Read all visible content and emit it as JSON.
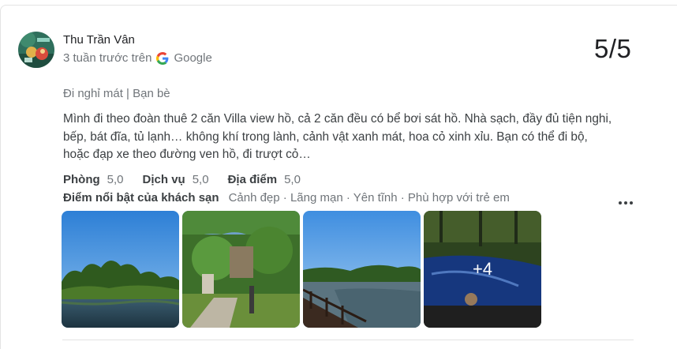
{
  "review": {
    "author": "Thu Trần Vân",
    "time": "3 tuần trước trên",
    "source": "Google",
    "score": "5/5",
    "tags": "Đi nghỉ mát | Bạn bè",
    "text": "Mình đi theo đoàn thuê 2 căn Villa view hồ, cả 2 căn đều có bể bơi sát hồ. Nhà sạch, đầy đủ tiện nghi, bếp, bát đĩa, tủ lạnh… không khí trong lành, cảnh vật xanh mát, hoa cỏ xinh xỉu. Bạn có thể đi bộ, hoặc đạp xe theo đường ven hồ, đi trượt cỏ…",
    "ratings": [
      {
        "label": "Phòng",
        "value": "5,0"
      },
      {
        "label": "Dịch vụ",
        "value": "5,0"
      },
      {
        "label": "Địa điểm",
        "value": "5,0"
      }
    ],
    "highlights_label": "Điểm nổi bật của khách sạn",
    "highlights": "Cảnh đẹp · Lãng mạn · Yên tĩnh · Phù hợp với trẻ em",
    "more_photos": "+4"
  },
  "colors": {
    "text_primary": "#202124",
    "text_secondary": "#70757a",
    "divider": "#e3e3e3"
  },
  "icons": [
    "avatar",
    "google-g-icon",
    "more-options-icon"
  ]
}
